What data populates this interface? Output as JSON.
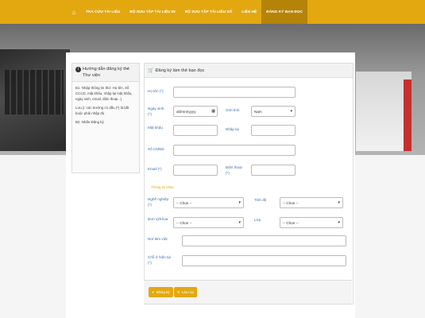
{
  "nav": {
    "items": [
      "TRA CỨU TÀI LIỆU",
      "BỘ SƯU TẬP TÀI LIỆU IN",
      "BỘ SƯU TẬP TÀI LIỆU SỐ",
      "LIÊN HỆ",
      "ĐĂNG KÝ BẠN ĐỌC"
    ],
    "active_index": 4,
    "home_icon": "home-icon"
  },
  "guide": {
    "title": "Hướng dẫn đăng ký thẻ Thư viện",
    "step1": "B1. Nhập thông tin thứ: Họ tên, Số CCCD, mật khẩu, nhập lại mật khẩu, ngày sinh, email, điện thoại...)",
    "note": "Lưu ý: các trường có dấu (*) là bắt buộc phải nhập đủ",
    "step2": "B2. Nhấn Đăng ký"
  },
  "form": {
    "title": "Đăng ký làm thẻ bạn đọc",
    "hoten_label": "Họ tên (*)",
    "ngaysinh_label": "Ngày sinh (*)",
    "ngaysinh_placeholder": "dd/mm/yyyy",
    "gioitinh_label": "Giới tính",
    "gioitinh_value": "Nam",
    "matkhau_label": "Mật khẩu",
    "nhaplai_label": "Nhập lại",
    "socmnd_label": "Số CMND",
    "email_label": "Email (*)",
    "dienthoai_label": "Điện thoại (*)",
    "section_label": "Thông tin khác",
    "nghenghiep_label": "Nghề nghiệp (*)",
    "nghenghiep_value": "-- Chọn --",
    "tinhdo_label": "Tỉnh độ",
    "tinhdo_value": "-- Chọn --",
    "donvi_label": "Đơn vị/Khoa",
    "donvi_value": "-- Chọn --",
    "lop_label": "Lớp",
    "lop_value": "-- Chọn --",
    "noilamviec_label": "Nơi làm việc",
    "chohientai_label": "Chỗ ở hiện tại (*)",
    "submit_label": "Đăng ký",
    "reset_label": "Làm lại"
  }
}
